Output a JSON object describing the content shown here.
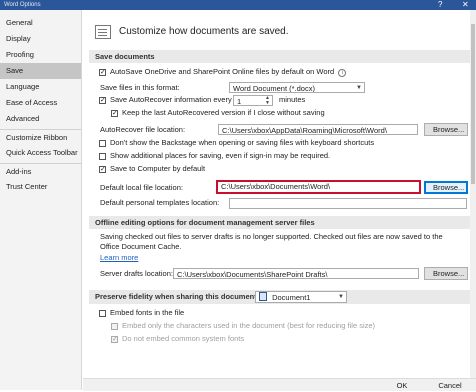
{
  "window": {
    "title": "Word Options",
    "help_glyph": "?",
    "close_glyph": "✕"
  },
  "sidebar": {
    "items": [
      {
        "label": "General"
      },
      {
        "label": "Display"
      },
      {
        "label": "Proofing"
      },
      {
        "label": "Save",
        "selected": true
      },
      {
        "label": "Language"
      },
      {
        "label": "Ease of Access"
      },
      {
        "label": "Advanced"
      },
      {
        "label": "Customize Ribbon"
      },
      {
        "label": "Quick Access Toolbar"
      },
      {
        "label": "Add-ins"
      },
      {
        "label": "Trust Center"
      }
    ]
  },
  "header": {
    "text": "Customize how documents are saved.",
    "icon": "save-document-icon"
  },
  "save_documents": {
    "title": "Save documents",
    "autosave_label": "AutoSave OneDrive and SharePoint Online files by default on Word",
    "autosave_checked": true,
    "format_label": "Save files in this format:",
    "format_value": "Word Document (*.docx)",
    "autorecover_label": "Save AutoRecover information every",
    "autorecover_checked": true,
    "autorecover_minutes": "1",
    "minutes_label": "minutes",
    "keep_label": "Keep the last AutoRecovered version if I close without saving",
    "keep_checked": true,
    "ar_location_label": "AutoRecover file location:",
    "ar_location_value": "C:\\Users\\xbox\\AppData\\Roaming\\Microsoft\\Word\\",
    "browse_label": "Browse...",
    "backstage_label": "Don't show the Backstage when opening or saving files with keyboard shortcuts",
    "backstage_checked": false,
    "additional_label": "Show additional places for saving, even if sign-in may be required.",
    "additional_checked": false,
    "computer_label": "Save to Computer by default",
    "computer_checked": true,
    "default_local_label": "Default local file location:",
    "default_local_value": "C:\\Users\\xbox\\Documents\\Word\\",
    "browse2_label": "Browse...",
    "templates_label": "Default personal templates location:",
    "templates_value": ""
  },
  "offline": {
    "title": "Offline editing options for document management server files",
    "desc": "Saving checked out files to server drafts is no longer supported. Checked out files are now saved to the Office Document Cache.",
    "learn_more": "Learn more",
    "drafts_label": "Server drafts location:",
    "drafts_value": "C:\\Users\\xbox\\Documents\\SharePoint Drafts\\",
    "browse_label": "Browse..."
  },
  "fidelity": {
    "title": "Preserve fidelity when sharing this document:",
    "document": "Document1",
    "embed_label": "Embed fonts in the file",
    "embed_checked": false,
    "embed_only_label": "Embed only the characters used in the document (best for reducing file size)",
    "embed_only_checked": false,
    "no_common_label": "Do not embed common system fonts",
    "no_common_checked": true
  },
  "footer": {
    "ok": "OK",
    "cancel": "Cancel"
  },
  "colors": {
    "title_bar": "#2b579a",
    "highlight_border": "#c8102e",
    "focus": "#0078d7"
  }
}
